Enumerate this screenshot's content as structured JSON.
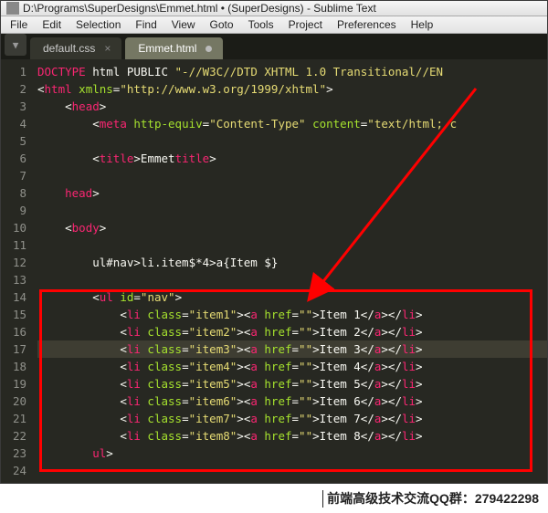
{
  "title": "D:\\Programs\\SuperDesigns\\Emmet.html • (SuperDesigns) - Sublime Text",
  "menu": [
    "File",
    "Edit",
    "Selection",
    "Find",
    "View",
    "Goto",
    "Tools",
    "Project",
    "Preferences",
    "Help"
  ],
  "tabs": [
    {
      "label": "default.css",
      "active": false,
      "dirty": false
    },
    {
      "label": "Emmet.html",
      "active": true,
      "dirty": true
    }
  ],
  "lines": [
    "1",
    "2",
    "3",
    "4",
    "5",
    "6",
    "7",
    "8",
    "9",
    "10",
    "11",
    "12",
    "13",
    "14",
    "15",
    "16",
    "17",
    "18",
    "19",
    "20",
    "21",
    "22",
    "23",
    "24"
  ],
  "code": {
    "l1a": "<!",
    "l1b": "DOCTYPE",
    "l1c": " html PUBLIC ",
    "l1d": "\"-//W3C//DTD XHTML 1.0 Transitional//EN",
    "l2a": "<",
    "l2b": "html",
    "l2c": " xmlns",
    "l2d": "=",
    "l2e": "\"http://www.w3.org/1999/xhtml\"",
    "l2f": ">",
    "l3a": "<",
    "l3b": "head",
    "l3c": ">",
    "l4a": "<",
    "l4b": "meta",
    "l4c": " http-equiv",
    "l4d": "=",
    "l4e": "\"Content-Type\"",
    "l4f": " content",
    "l4g": "=",
    "l4h": "\"text/html; c",
    "l6a": "<",
    "l6b": "title",
    "l6c": ">",
    "l6d": "Emmet",
    "l6e": "</",
    "l6f": "title",
    "l6g": ">",
    "l8a": "</",
    "l8b": "head",
    "l8c": ">",
    "l10a": "<",
    "l10b": "body",
    "l10c": ">",
    "l12a": "ul#nav>li.item$*4>a{Item $}",
    "l14a": "<",
    "l14b": "ul",
    "l14c": " id",
    "l14d": "=",
    "l14e": "\"nav\"",
    "l14f": ">",
    "li": [
      {
        "cls": "\"item1\"",
        "txt": "Item 1"
      },
      {
        "cls": "\"item2\"",
        "txt": "Item 2"
      },
      {
        "cls": "\"item3\"",
        "txt": "Item 3"
      },
      {
        "cls": "\"item4\"",
        "txt": "Item 4"
      },
      {
        "cls": "\"item5\"",
        "txt": "Item 5"
      },
      {
        "cls": "\"item6\"",
        "txt": "Item 6"
      },
      {
        "cls": "\"item7\"",
        "txt": "Item 7"
      },
      {
        "cls": "\"item8\"",
        "txt": "Item 8"
      }
    ],
    "l23a": "</",
    "l23b": "ul",
    "l23c": ">"
  },
  "footer": {
    "text": "前端高级技术交流QQ群：279422298"
  }
}
